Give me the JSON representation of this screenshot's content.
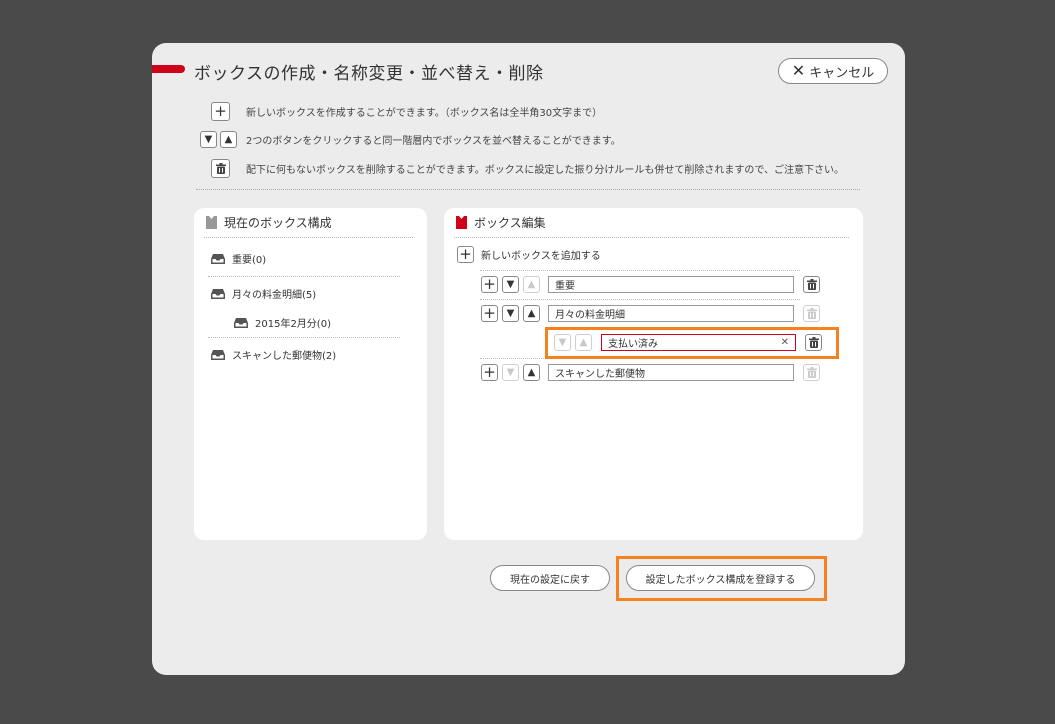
{
  "dialog": {
    "title": "ボックスの作成・名称変更・並べ替え・削除",
    "cancel_label": "キャンセル"
  },
  "help": {
    "add_text": "新しいボックスを作成することができます。（ボックス名は全半角30文字まで）",
    "sort_text": "2つのボタンをクリックすると同一階層内でボックスを並べ替えることができます。",
    "delete_text": "配下に何もないボックスを削除することができます。ボックスに設定した振り分けルールも併せて削除されますので、ご注意下さい。"
  },
  "current_panel": {
    "title": "現在のボックス構成",
    "items": [
      {
        "label": "重要(0)"
      },
      {
        "label": "月々の料金明細(5)"
      },
      {
        "label": "2015年2月分(0)"
      },
      {
        "label": "スキャンした郵便物(2)"
      }
    ]
  },
  "edit_panel": {
    "title": "ボックス編集",
    "add_label": "新しいボックスを追加する",
    "rows": [
      {
        "value": "重要"
      },
      {
        "value": "月々の料金明細"
      },
      {
        "value": "支払い済み"
      },
      {
        "value": "スキャンした郵便物"
      }
    ]
  },
  "footer": {
    "reset_label": "現在の設定に戻す",
    "register_label": "設定したボックス構成を登録する"
  },
  "colors": {
    "accent": "#d0021b",
    "highlight": "#f5821f",
    "background": "#4a4a4a",
    "dialog": "#ececec"
  }
}
